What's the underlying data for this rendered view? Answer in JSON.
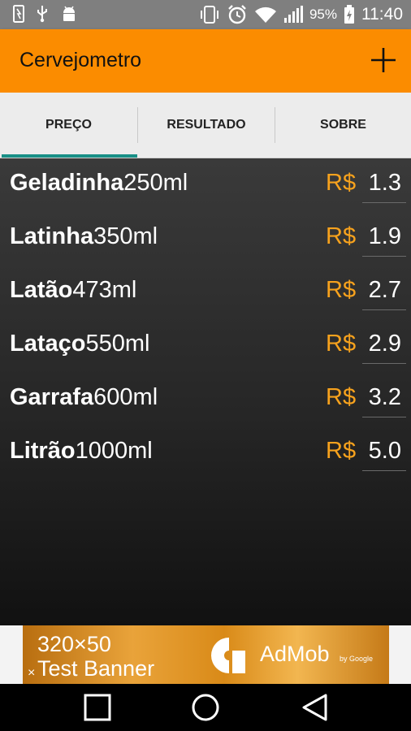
{
  "status_bar": {
    "battery": "95%",
    "time": "11:40",
    "icons": [
      "usb-storage-icon",
      "usb-icon",
      "android-debug-icon",
      "vibrate-icon",
      "alarm-icon",
      "wifi-icon",
      "signal-icon",
      "battery-icon"
    ]
  },
  "app_bar": {
    "title": "Cervejometro",
    "action_icon": "add-icon"
  },
  "tabs": [
    {
      "label": "PREÇO",
      "selected": true
    },
    {
      "label": "RESULTADO",
      "selected": false
    },
    {
      "label": "SOBRE",
      "selected": false
    }
  ],
  "beers": [
    {
      "name": "Geladinha",
      "volume": "250ml",
      "currency": "R$",
      "price": "1.3"
    },
    {
      "name": "Latinha",
      "volume": "350ml",
      "currency": "R$",
      "price": "1.9"
    },
    {
      "name": "Latão",
      "volume": "473ml",
      "currency": "R$",
      "price": "2.7"
    },
    {
      "name": "Lataço",
      "volume": "550ml",
      "currency": "R$",
      "price": "2.9"
    },
    {
      "name": "Garrafa",
      "volume": "600ml",
      "currency": "R$",
      "price": "3.2"
    },
    {
      "name": "Litrão",
      "volume": "1000ml",
      "currency": "R$",
      "price": "5.0"
    }
  ],
  "ad_banner": {
    "line1": "320×50",
    "line2": "Test Banner",
    "brand": "AdMob",
    "brand_sub": "by Google",
    "close": "×"
  },
  "nav_bar": {
    "icons": [
      "recents-icon",
      "home-icon",
      "back-icon"
    ]
  },
  "colors": {
    "app_bar": "#fb8c00",
    "currency": "#f7a21d",
    "tab_indicator": "#188f86"
  }
}
